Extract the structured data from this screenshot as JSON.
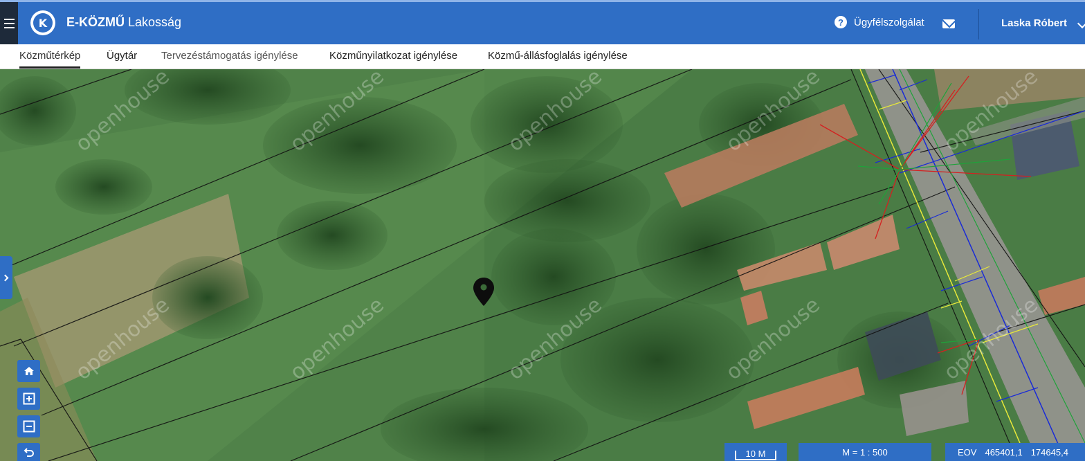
{
  "header": {
    "logo_letter": "K",
    "brand_bold": "E-KÖZMŰ",
    "brand_light": "Lakosság",
    "help_label": "Ügyfélszolgálat",
    "help_icon": "question-circle-icon",
    "mail_icon": "envelope-icon",
    "user_name": "Laska Róbert"
  },
  "tabs": [
    {
      "label": "Közműtérkép",
      "active": true
    },
    {
      "label": "Ügytár"
    },
    {
      "label": "Tervezéstámogatás igénylése"
    },
    {
      "label": "Közműnyilatkozat igénylése"
    },
    {
      "label": "Közmű-állásfoglalás igénylése"
    }
  ],
  "map": {
    "watermark": "openhouse",
    "controls": [
      "home-icon",
      "zoom-in-icon",
      "zoom-out-icon",
      "undo-icon"
    ]
  },
  "status": {
    "scale_label": "10 M",
    "ratio_label": "M = 1 : 500",
    "coord_label": "EOV",
    "coord_x": "465401,1",
    "coord_y": "174645,4"
  },
  "colors": {
    "primary": "#2f6ec5",
    "menu_bg": "#1e2a3a"
  }
}
